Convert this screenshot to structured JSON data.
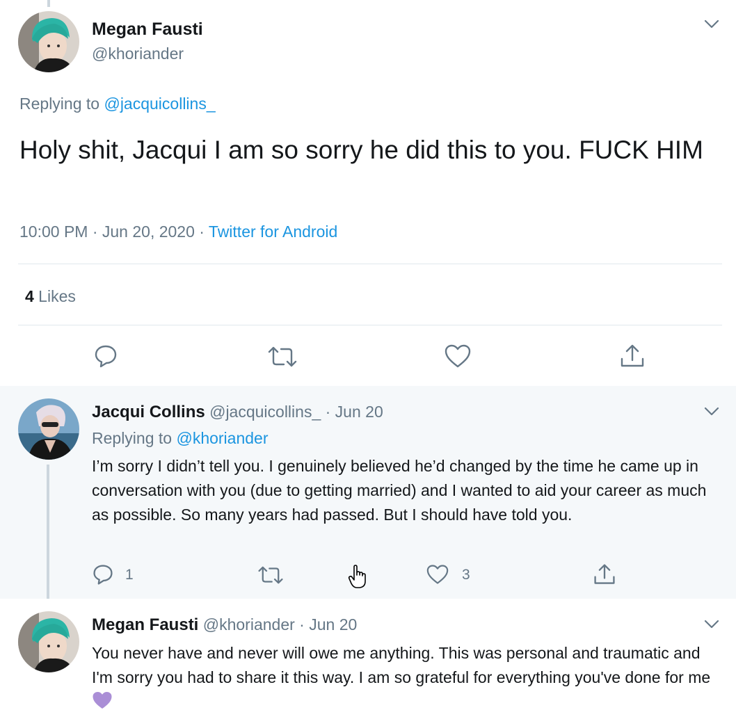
{
  "main_tweet": {
    "author_name": "Megan Fausti",
    "author_handle": "@khoriander",
    "replying_prefix": "Replying to ",
    "replying_handle": "@jacquicollins_",
    "text": "Holy shit, Jacqui I am so sorry he did this to you. FUCK HIM",
    "time": "10:00 PM · Jun 20, 2020 · ",
    "source": "Twitter for Android",
    "likes_count": "4",
    "likes_label": " Likes"
  },
  "replies": [
    {
      "author_name": "Jacqui Collins",
      "meta": " @jacquicollins_ · Jun 20",
      "replying_prefix": "Replying to ",
      "replying_handle": "@khoriander",
      "text": "I’m sorry I didn’t tell you. I genuinely believed he’d changed by the time he came up in conversation with you (due to getting married) and I wanted to aid your career as much as possible. So many years had passed. But I should have told you.",
      "reply_count": "1",
      "like_count": "3"
    },
    {
      "author_name": "Megan Fausti",
      "meta": " @khoriander · Jun 20",
      "text": "You never have and never will owe me anything. This was personal and traumatic and I'm sorry you had to share it this way. I am so grateful for everything you've done for me"
    }
  ],
  "icons": {
    "reply": "reply-icon",
    "retweet": "retweet-icon",
    "like": "heart-icon",
    "share": "share-icon",
    "more": "chevron-down-icon",
    "emoji": "purple-heart-emoji"
  },
  "colors": {
    "link": "#1b95e0",
    "muted": "#657786",
    "text": "#14171a",
    "reply_bg": "#f5f8fa",
    "purple_heart": "#aa8ed6"
  }
}
